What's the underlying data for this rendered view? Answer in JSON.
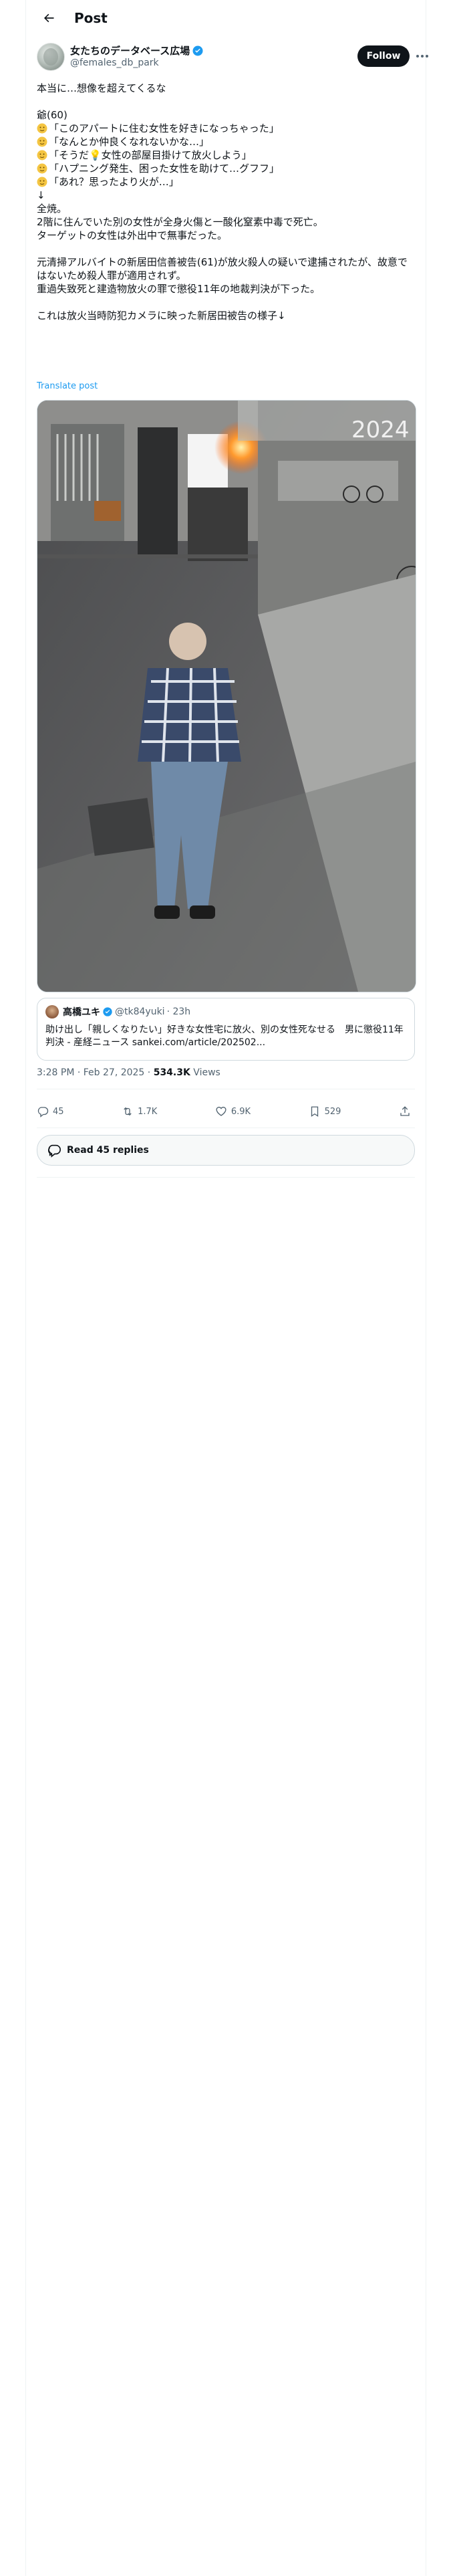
{
  "header": {
    "title": "Post"
  },
  "author": {
    "display_name": "女たちのデータベース広場",
    "handle": "@females_db_park",
    "follow_label": "Follow"
  },
  "tweet": {
    "lines": [
      "本当に…想像を超えてくるな",
      "",
      "爺(60)",
      "「このアパートに住む女性を好きになっちゃった」",
      "「なんとか仲良くなれないかな…」",
      "「そうだ💡女性の部屋目掛けて放火しよう」",
      "「ハプニング発生、困った女性を助けて…グフフ」",
      "「あれ？思ったより火が…」",
      "↓",
      "全焼。",
      "2階に住んでいた別の女性が全身火傷と一酸化窒素中毒で死亡。",
      "ターゲットの女性は外出中で無事だった。",
      "",
      "元清掃アルバイトの新居田信善被告(61)が放火殺人の疑いで逮捕されたが、故意ではないため殺人罪が適用されず。",
      "重過失致死と建造物放火の罪で懲役11年の地裁判決が下った。",
      "",
      "これは放火当時防犯カメラに映った新居田被告の様子↓"
    ],
    "translate_label": "Translate post"
  },
  "media": {
    "overlay_text": "2024"
  },
  "quote": {
    "name": "高橋ユキ",
    "handle": "@tk84yuki",
    "time": "· 23h",
    "body": "助け出し「親しくなりたい」好きな女性宅に放火、別の女性死なせる　男に懲役11年判決 - 産経ニュース sankei.com/article/202502..."
  },
  "meta": {
    "timestamp": "3:28 PM · Feb 27, 2025 · ",
    "views_count": "534.3K",
    "views_label": " Views"
  },
  "actions": {
    "replies": "45",
    "reposts": "1.7K",
    "likes": "6.9K",
    "bookmarks": "529"
  },
  "read_replies_label": "Read 45 replies",
  "colors": {
    "accent": "#1d9bf0",
    "text": "#0f1419",
    "muted": "#536471",
    "emoji_yellow": "#f4c542"
  }
}
